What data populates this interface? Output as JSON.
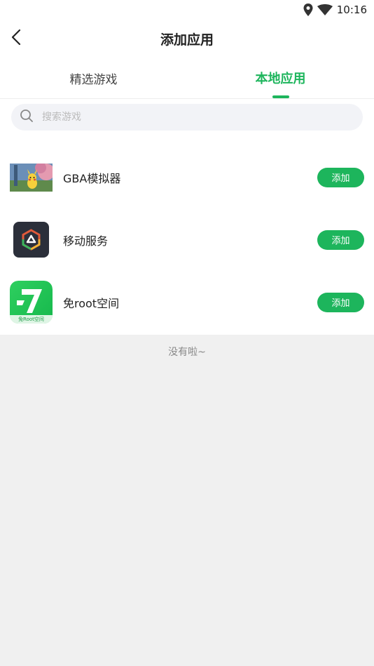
{
  "status": {
    "time": "10:16",
    "icons": [
      "location-icon",
      "wifi-icon"
    ]
  },
  "header": {
    "title": "添加应用",
    "back_icon": "chevron-left-icon"
  },
  "tabs": [
    {
      "label": "精选游戏",
      "active": false
    },
    {
      "label": "本地应用",
      "active": true
    }
  ],
  "search": {
    "placeholder": "搜索游戏",
    "value": "",
    "icon": "search-icon"
  },
  "apps": [
    {
      "name": "GBA模拟器",
      "button": "添加",
      "icon": "gba-emulator-icon"
    },
    {
      "name": "移动服务",
      "button": "添加",
      "icon": "mobile-service-icon"
    },
    {
      "name": "免root空间",
      "button": "添加",
      "icon": "root-free-space-icon",
      "icon_caption": "免Root空间"
    }
  ],
  "footer": {
    "empty_text": "没有啦~"
  },
  "colors": {
    "accent": "#1db55c",
    "background": "#f0f0f0",
    "search_bg": "#f2f3f7"
  }
}
